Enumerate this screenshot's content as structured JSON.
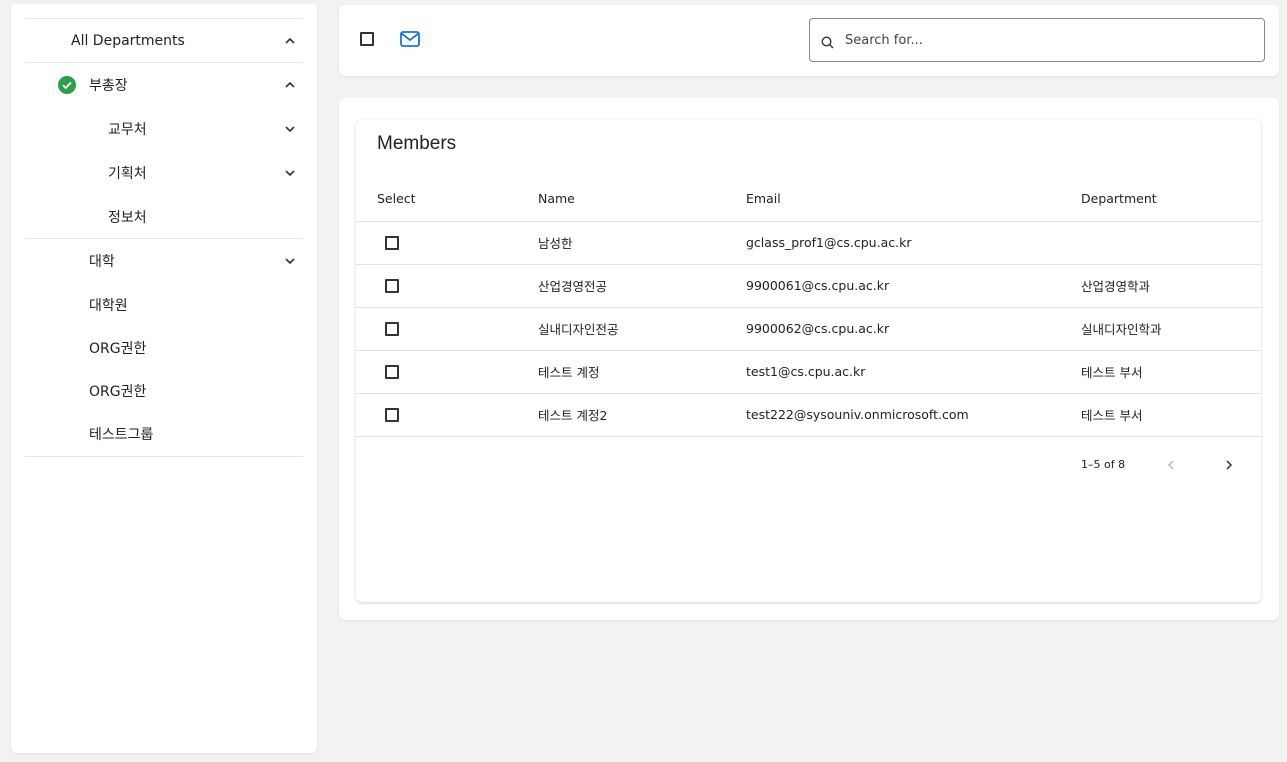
{
  "sidebar": {
    "items": [
      {
        "label": "All Departments",
        "level": 0,
        "chevron": "up"
      },
      {
        "label": "부총장",
        "level": 1,
        "chevron": "up",
        "checked": true
      },
      {
        "label": "교무처",
        "level": 2,
        "chevron": "down"
      },
      {
        "label": "기획처",
        "level": 2,
        "chevron": "down"
      },
      {
        "label": "정보처",
        "level": 2,
        "chevron": "none"
      },
      {
        "label": "대학",
        "level": 1,
        "chevron": "down"
      },
      {
        "label": "대학원",
        "level": 1,
        "chevron": "none"
      },
      {
        "label": "ORG권한",
        "level": 1,
        "chevron": "none"
      },
      {
        "label": "ORG권한",
        "level": 1,
        "chevron": "none"
      },
      {
        "label": "테스트그룹",
        "level": 1,
        "chevron": "none"
      }
    ]
  },
  "toolbar": {
    "select_all_icon": "checkbox-icon",
    "mail_icon": "mail-icon",
    "search_placeholder": "Search for..."
  },
  "members": {
    "title": "Members",
    "columns": [
      "Select",
      "Name",
      "Email",
      "Department"
    ],
    "rows": [
      {
        "name": "남성한",
        "email": "gclass_prof1@cs.cpu.ac.kr",
        "department": ""
      },
      {
        "name": "산업경영전공",
        "email": "9900061@cs.cpu.ac.kr",
        "department": "산업경영학과"
      },
      {
        "name": "실내디자인전공",
        "email": "9900062@cs.cpu.ac.kr",
        "department": "실내디자인학과"
      },
      {
        "name": "테스트 계정",
        "email": "test1@cs.cpu.ac.kr",
        "department": "테스트 부서"
      },
      {
        "name": "테스트 계정2",
        "email": "test222@sysouniv.onmicrosoft.com",
        "department": "테스트 부서"
      }
    ],
    "pagination": {
      "range": "1–5 of 8"
    }
  },
  "colors": {
    "accent": "#1976d2",
    "check_green": "#2e9e48",
    "background": "#f2f2f2"
  }
}
